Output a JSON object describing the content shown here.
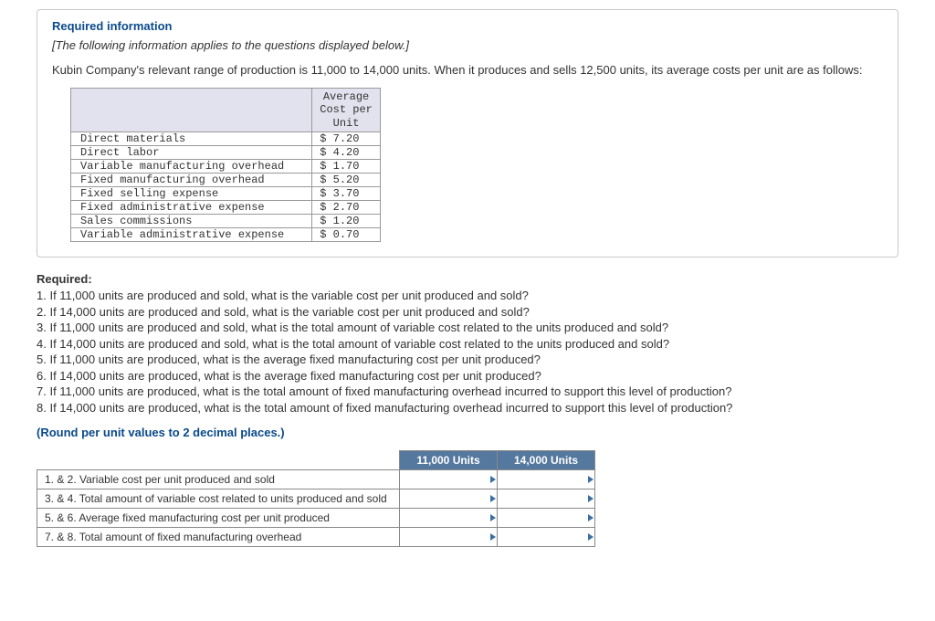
{
  "header": {
    "title": "Required information",
    "note": "[The following information applies to the questions displayed below.]",
    "intro": "Kubin Company's relevant range of production is 11,000 to 14,000 units. When it produces and sells 12,500 units, its average costs per unit are as follows:"
  },
  "cost_table": {
    "header": "Average\nCost per\nUnit",
    "rows": [
      {
        "label": "Direct materials",
        "value": "$ 7.20"
      },
      {
        "label": "Direct labor",
        "value": "$ 4.20"
      },
      {
        "label": "Variable manufacturing overhead",
        "value": "$ 1.70"
      },
      {
        "label": "Fixed manufacturing overhead",
        "value": "$ 5.20"
      },
      {
        "label": "Fixed selling expense",
        "value": "$ 3.70"
      },
      {
        "label": "Fixed administrative expense",
        "value": "$ 2.70"
      },
      {
        "label": "Sales commissions",
        "value": "$ 1.20"
      },
      {
        "label": "Variable administrative expense",
        "value": "$ 0.70"
      }
    ]
  },
  "required": {
    "label": "Required:",
    "questions": [
      "1. If 11,000 units are produced and sold, what is the variable cost per unit produced and sold?",
      "2. If 14,000 units are produced and sold, what is the variable cost per unit produced and sold?",
      "3. If 11,000 units are produced and sold, what is the total amount of variable cost related to the units produced and sold?",
      "4. If 14,000 units are produced and sold, what is the total amount of variable cost related to the units produced and sold?",
      "5. If 11,000 units are produced, what is the average fixed manufacturing cost per unit produced?",
      "6. If 14,000 units are produced, what is the average fixed manufacturing cost per unit produced?",
      "7. If 11,000 units are produced, what is the total amount of fixed manufacturing overhead incurred to support this level of production?",
      "8. If 14,000 units are produced, what is the total amount of fixed manufacturing overhead incurred to support this level of production?"
    ],
    "round_note": "(Round per unit values to 2 decimal places.)"
  },
  "answer_table": {
    "col1": "11,000 Units",
    "col2": "14,000 Units",
    "rows": [
      "1. & 2. Variable cost per unit produced and sold",
      "3. & 4. Total amount of variable cost related to units produced and sold",
      "5. & 6. Average fixed manufacturing cost per unit produced",
      "7. & 8. Total amount of fixed manufacturing overhead"
    ]
  }
}
